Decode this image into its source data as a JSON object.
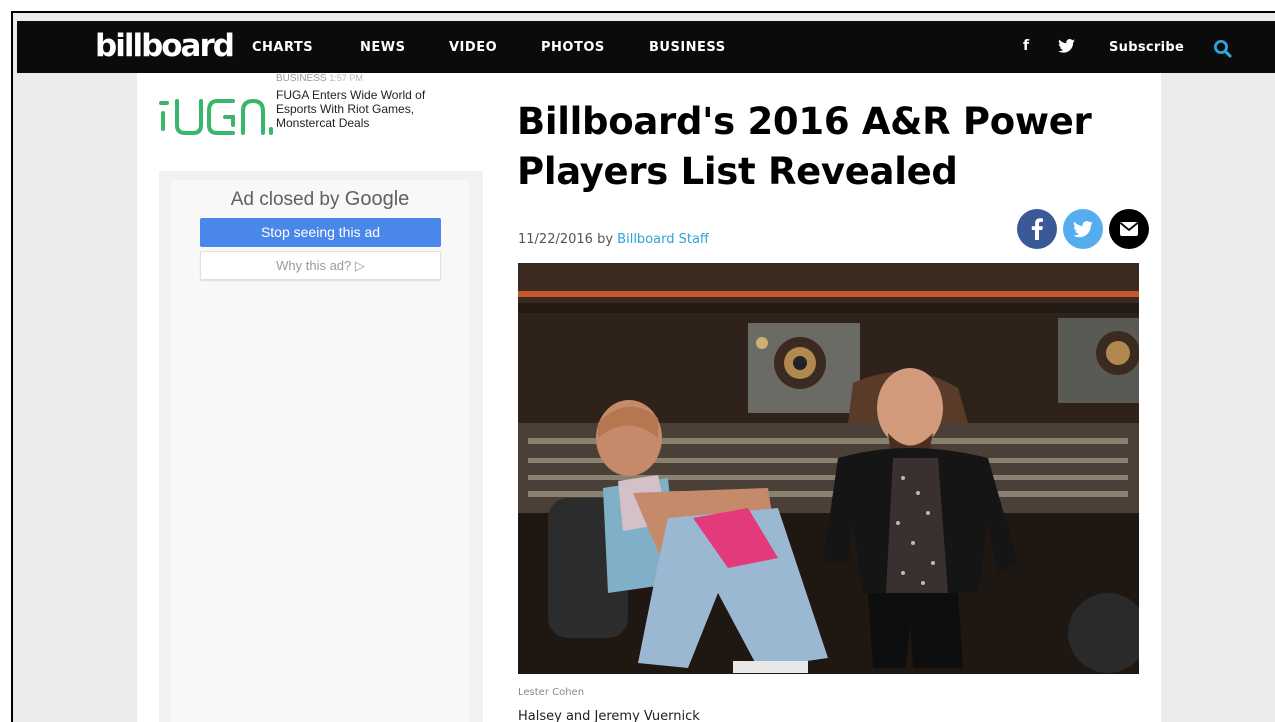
{
  "nav": {
    "logo": "billboard",
    "items": [
      "CHARTS",
      "NEWS",
      "VIDEO",
      "PHOTOS",
      "BUSINESS"
    ],
    "facebook_glyph": "f",
    "subscribe": "Subscribe"
  },
  "sidebar": {
    "promo": {
      "category": "BUSINESS",
      "time": "1:57 PM",
      "title": "FUGA Enters Wide World of Esports With Riot Games, Monstercat Deals"
    },
    "ad": {
      "closed_prefix": "Ad closed by",
      "closed_brand": "Google",
      "stop_label": "Stop seeing this ad",
      "why_label": "Why this ad? ▷"
    }
  },
  "article": {
    "headline": "Billboard's 2016 A&R Power Players List Revealed",
    "date": "11/22/2016",
    "by": "by",
    "author": "Billboard Staff",
    "photo_credit": "Lester Cohen",
    "caption": "Halsey and Jeremy Vuernick"
  },
  "colors": {
    "nav_bg": "#0b0b0b",
    "accent_blue": "#2ea3dc",
    "facebook": "#3b5998",
    "twitter": "#55acee",
    "ad_button": "#4a87ea"
  },
  "icons": [
    "facebook-icon",
    "twitter-icon",
    "search-icon",
    "email-icon"
  ]
}
